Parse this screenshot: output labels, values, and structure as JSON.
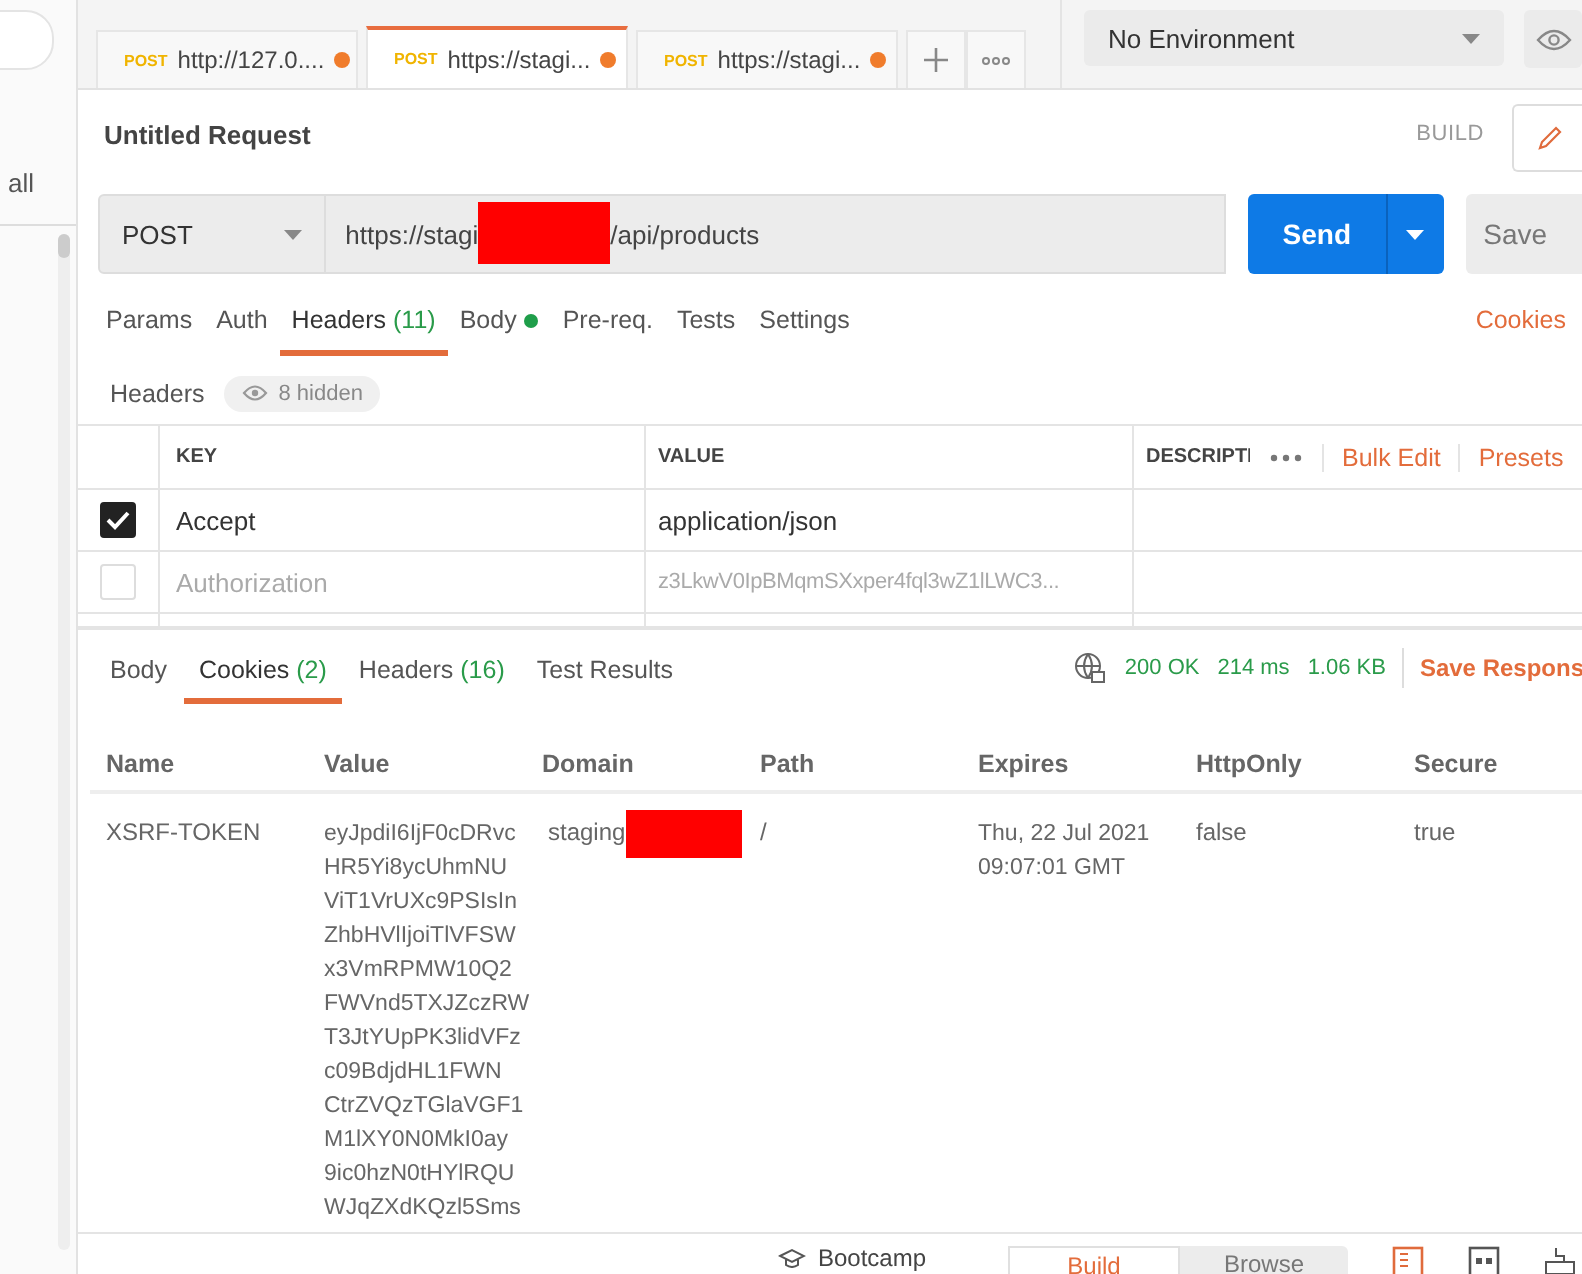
{
  "sidebar": {
    "filter_label": "all"
  },
  "request_tabs": [
    {
      "method": "POST",
      "label": "http://127.0....",
      "unsaved": true,
      "selected": false
    },
    {
      "method": "POST",
      "label": "https://stagi...",
      "unsaved": true,
      "selected": true
    },
    {
      "method": "POST",
      "label": "https://stagi...",
      "unsaved": true,
      "selected": false
    }
  ],
  "environment": {
    "value": "No Environment"
  },
  "request": {
    "title": "Untitled Request",
    "mode": "BUILD",
    "method": "POST",
    "url_before": "https://stagi",
    "url_after": "/api/products",
    "send": "Send",
    "save": "Save"
  },
  "request_sections": [
    {
      "label": "Params",
      "dot": false,
      "selected": false
    },
    {
      "label": "Auth",
      "dot": false,
      "selected": false
    },
    {
      "label": "Headers",
      "count": "(11)",
      "dot": false,
      "selected": true
    },
    {
      "label": "Body",
      "dot": true,
      "selected": false
    },
    {
      "label": "Pre-req.",
      "dot": false,
      "selected": false
    },
    {
      "label": "Tests",
      "dot": false,
      "selected": false
    },
    {
      "label": "Settings",
      "dot": false,
      "selected": false
    }
  ],
  "cookies_link": "Cookies",
  "headers": {
    "title": "Headers",
    "hidden": "8 hidden",
    "columns": [
      "KEY",
      "VALUE",
      "DESCRIPTI"
    ],
    "bulk_edit": "Bulk Edit",
    "presets": "Presets",
    "rows": [
      {
        "key": "Accept",
        "value": "application/json",
        "checked": true
      },
      {
        "key": "Authorization",
        "value": "z3LkwV0IpBMqmSXxper4fql3wZ1lLWC3...",
        "checked": false
      }
    ]
  },
  "response_sections": [
    {
      "label": "Body",
      "selected": false
    },
    {
      "label": "Cookies",
      "count": "(2)",
      "selected": true
    },
    {
      "label": "Headers",
      "count": "(16)",
      "selected": false
    },
    {
      "label": "Test Results",
      "selected": false
    }
  ],
  "response_status": {
    "status": "200 OK",
    "time": "214 ms",
    "size": "1.06 KB",
    "save": "Save Respons"
  },
  "cookies": {
    "columns": [
      "Name",
      "Value",
      "Domain",
      "Path",
      "Expires",
      "HttpOnly",
      "Secure"
    ],
    "rows": [
      {
        "name": "XSRF-TOKEN",
        "value_lines": [
          "eyJpdiI6IjF0cDRvc",
          "HR5Yi8ycUhmNU",
          "ViT1VrUXc9PSIsIn",
          "ZhbHVlIjoiTlVFSW",
          "x3VmRPMW10Q2",
          "FWVnd5TXJZczRW",
          "T3JtYUpPK3lidVFz",
          "c09BdjdHL1FWN",
          "CtrZVQzTGlaVGF1",
          "M1lXY0N0MkI0ay",
          "9ic0hzN0tHYlRQU",
          "WJqZXdKQzl5Sms"
        ],
        "domain": "staging",
        "path": "/",
        "expires_lines": [
          "Thu, 22 Jul 2021",
          "09:07:01 GMT"
        ],
        "http_only": "false",
        "secure": "true"
      }
    ]
  },
  "status_bar": {
    "bootcamp": "Bootcamp",
    "modes": [
      {
        "label": "Build",
        "selected": true
      },
      {
        "label": "Browse",
        "selected": false
      }
    ]
  }
}
